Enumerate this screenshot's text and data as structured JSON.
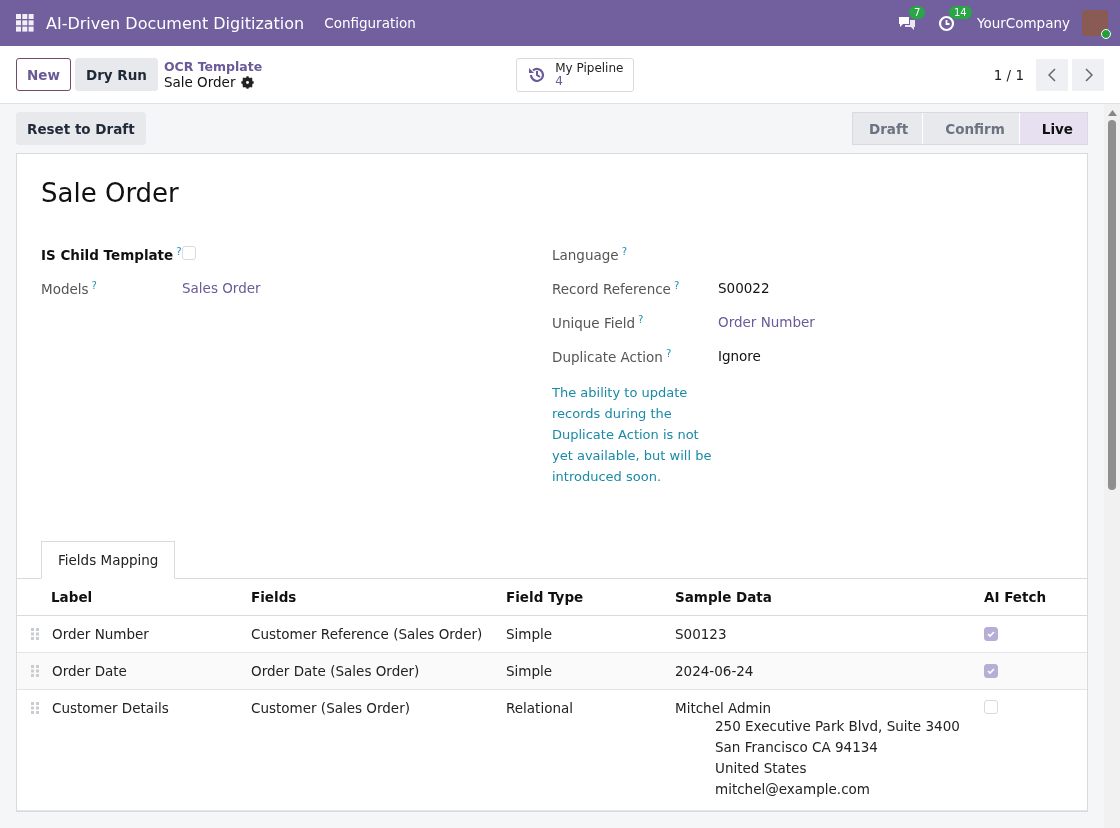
{
  "navbar": {
    "app_title": "AI-Driven Document Digitization",
    "menus": [
      "Configuration"
    ],
    "messages_count": "7",
    "activities_count": "14",
    "company": "YourCompany"
  },
  "control_panel": {
    "buttons": [
      {
        "label": "New",
        "kind": "outline"
      },
      {
        "label": "Dry Run",
        "kind": "secondary"
      }
    ],
    "breadcrumb": "OCR Template",
    "record_name": "Sale Order",
    "smart_button": {
      "label": "My Pipeline",
      "count": "4"
    },
    "pager": "1 / 1"
  },
  "header": {
    "buttons": [
      "Reset to Draft"
    ],
    "stages": [
      {
        "label": "Draft",
        "selected": false
      },
      {
        "label": "Confirm",
        "selected": false
      },
      {
        "label": "Live",
        "selected": true
      }
    ]
  },
  "form": {
    "title": "Sale Order",
    "left_fields": [
      {
        "label": "IS Child Template",
        "help": "?",
        "kind": "checkbox",
        "checked": false,
        "bold": true
      },
      {
        "label": "Models",
        "help": "?",
        "kind": "link",
        "value": "Sales Order",
        "bold": false
      }
    ],
    "right_fields": [
      {
        "label": "Language",
        "help": "?",
        "kind": "text",
        "bold": false
      },
      {
        "label": "Record Reference",
        "help": "?",
        "kind": "text",
        "value": "S00022",
        "bold": false
      },
      {
        "label": "Unique Field",
        "help": "?",
        "kind": "link",
        "value": "Order Number",
        "bold": false
      },
      {
        "label": "Duplicate Action",
        "help": "?",
        "kind": "text",
        "value": "Ignore",
        "bold": false
      }
    ],
    "note": "The ability to update records during the Duplicate Action is not yet available, but will be introduced soon.",
    "tabs": [
      {
        "label": "Fields Mapping",
        "selected": true
      }
    ],
    "table": {
      "columns": [
        "Label",
        "Fields",
        "Field Type",
        "Sample Data",
        "AI Fetch"
      ],
      "rows": [
        {
          "label": "Order Number",
          "field": "Customer Reference (Sales Order)",
          "field_type": "Simple",
          "sample_data": "S00123",
          "ai_fetch": true
        },
        {
          "label": "Order Date",
          "field": "Order Date (Sales Order)",
          "field_type": "Simple",
          "sample_data": "2024-06-24",
          "ai_fetch": true
        },
        {
          "label": "Customer Details",
          "field": "Customer (Sales Order)",
          "field_type": "Relational",
          "sample_data": "Mitchel Admin",
          "address_lines": [
            "250 Executive Park Blvd, Suite 3400",
            "San Francisco CA 94134",
            "United States",
            "mitchel@example.com"
          ],
          "ai_fetch": false
        }
      ]
    }
  }
}
